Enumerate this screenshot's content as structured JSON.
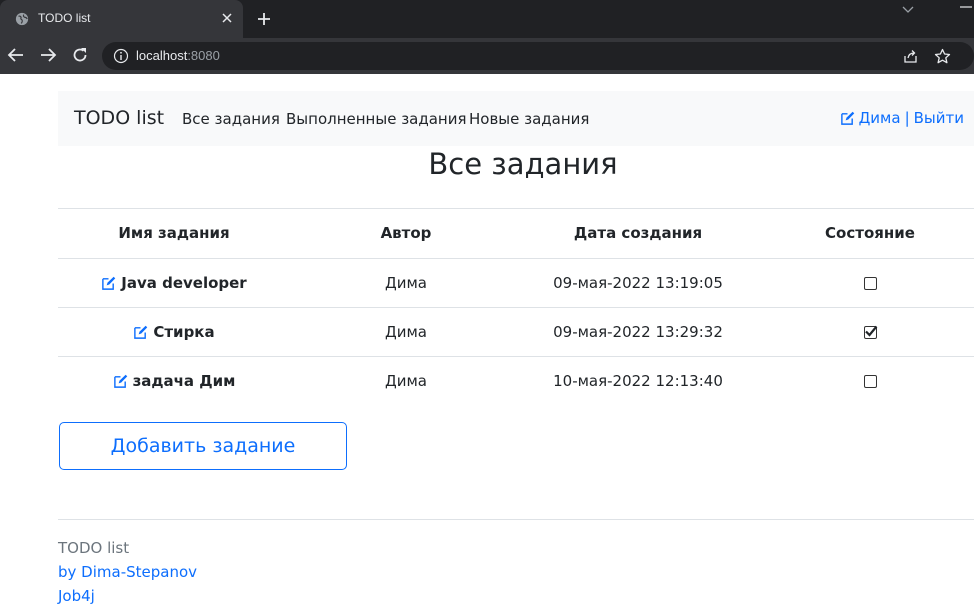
{
  "browser": {
    "tab_title": "TODO list",
    "url_host": "localhost",
    "url_port": ":8080"
  },
  "navbar": {
    "brand": "TODO list",
    "links": [
      "Все задания",
      "Выполненные задания",
      "Новые задания"
    ],
    "user": "Дима",
    "separator": "|",
    "logout": "Выйти"
  },
  "page_title": "Все задания",
  "table": {
    "headers": [
      "Имя задания",
      "Автор",
      "Дата создания",
      "Состояние"
    ],
    "rows": [
      {
        "name": "Java developer",
        "author": "Дима",
        "created": "09-мая-2022 13:19:05",
        "done": false
      },
      {
        "name": "Стирка",
        "author": "Дима",
        "created": "09-мая-2022 13:29:32",
        "done": true
      },
      {
        "name": "задача Дим",
        "author": "Дима",
        "created": "10-мая-2022 12:13:40",
        "done": false
      }
    ]
  },
  "add_button": "Добавить задание",
  "footer": {
    "title": "TODO list",
    "author_link": "by Dima-Stepanov",
    "org_link": "Job4j"
  },
  "colors": {
    "primary": "#0d6efd",
    "navbar_bg": "#f8f9fa",
    "chrome_dark": "#202124",
    "chrome_tab": "#35363a"
  }
}
